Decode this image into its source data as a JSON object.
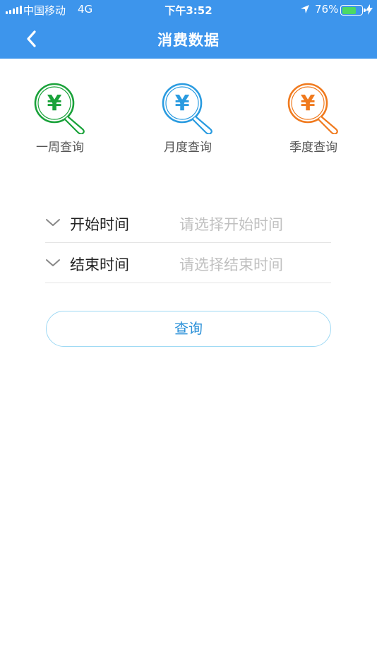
{
  "status_bar": {
    "carrier": "中国移动",
    "network": "4G",
    "time": "下午3:52",
    "battery_percent": "76%",
    "battery_level": 0.76
  },
  "navbar": {
    "title": "消费数据",
    "back_icon": "chevron-left-icon"
  },
  "quick_queries": [
    {
      "label": "一周查询",
      "icon": "yuan-magnifier-icon",
      "color": "#1aa23a"
    },
    {
      "label": "月度查询",
      "icon": "yuan-magnifier-icon",
      "color": "#2a9be0"
    },
    {
      "label": "季度查询",
      "icon": "yuan-magnifier-icon",
      "color": "#f07a1e"
    }
  ],
  "form": {
    "start": {
      "label": "开始时间",
      "placeholder": "请选择开始时间",
      "icon": "chevron-down-icon"
    },
    "end": {
      "label": "结束时间",
      "placeholder": "请选择结束时间",
      "icon": "chevron-down-icon"
    }
  },
  "query_button": {
    "label": "查询"
  },
  "colors": {
    "header": "#3d95ec",
    "button_border": "#9fd9f4",
    "button_text": "#2a90d8"
  }
}
